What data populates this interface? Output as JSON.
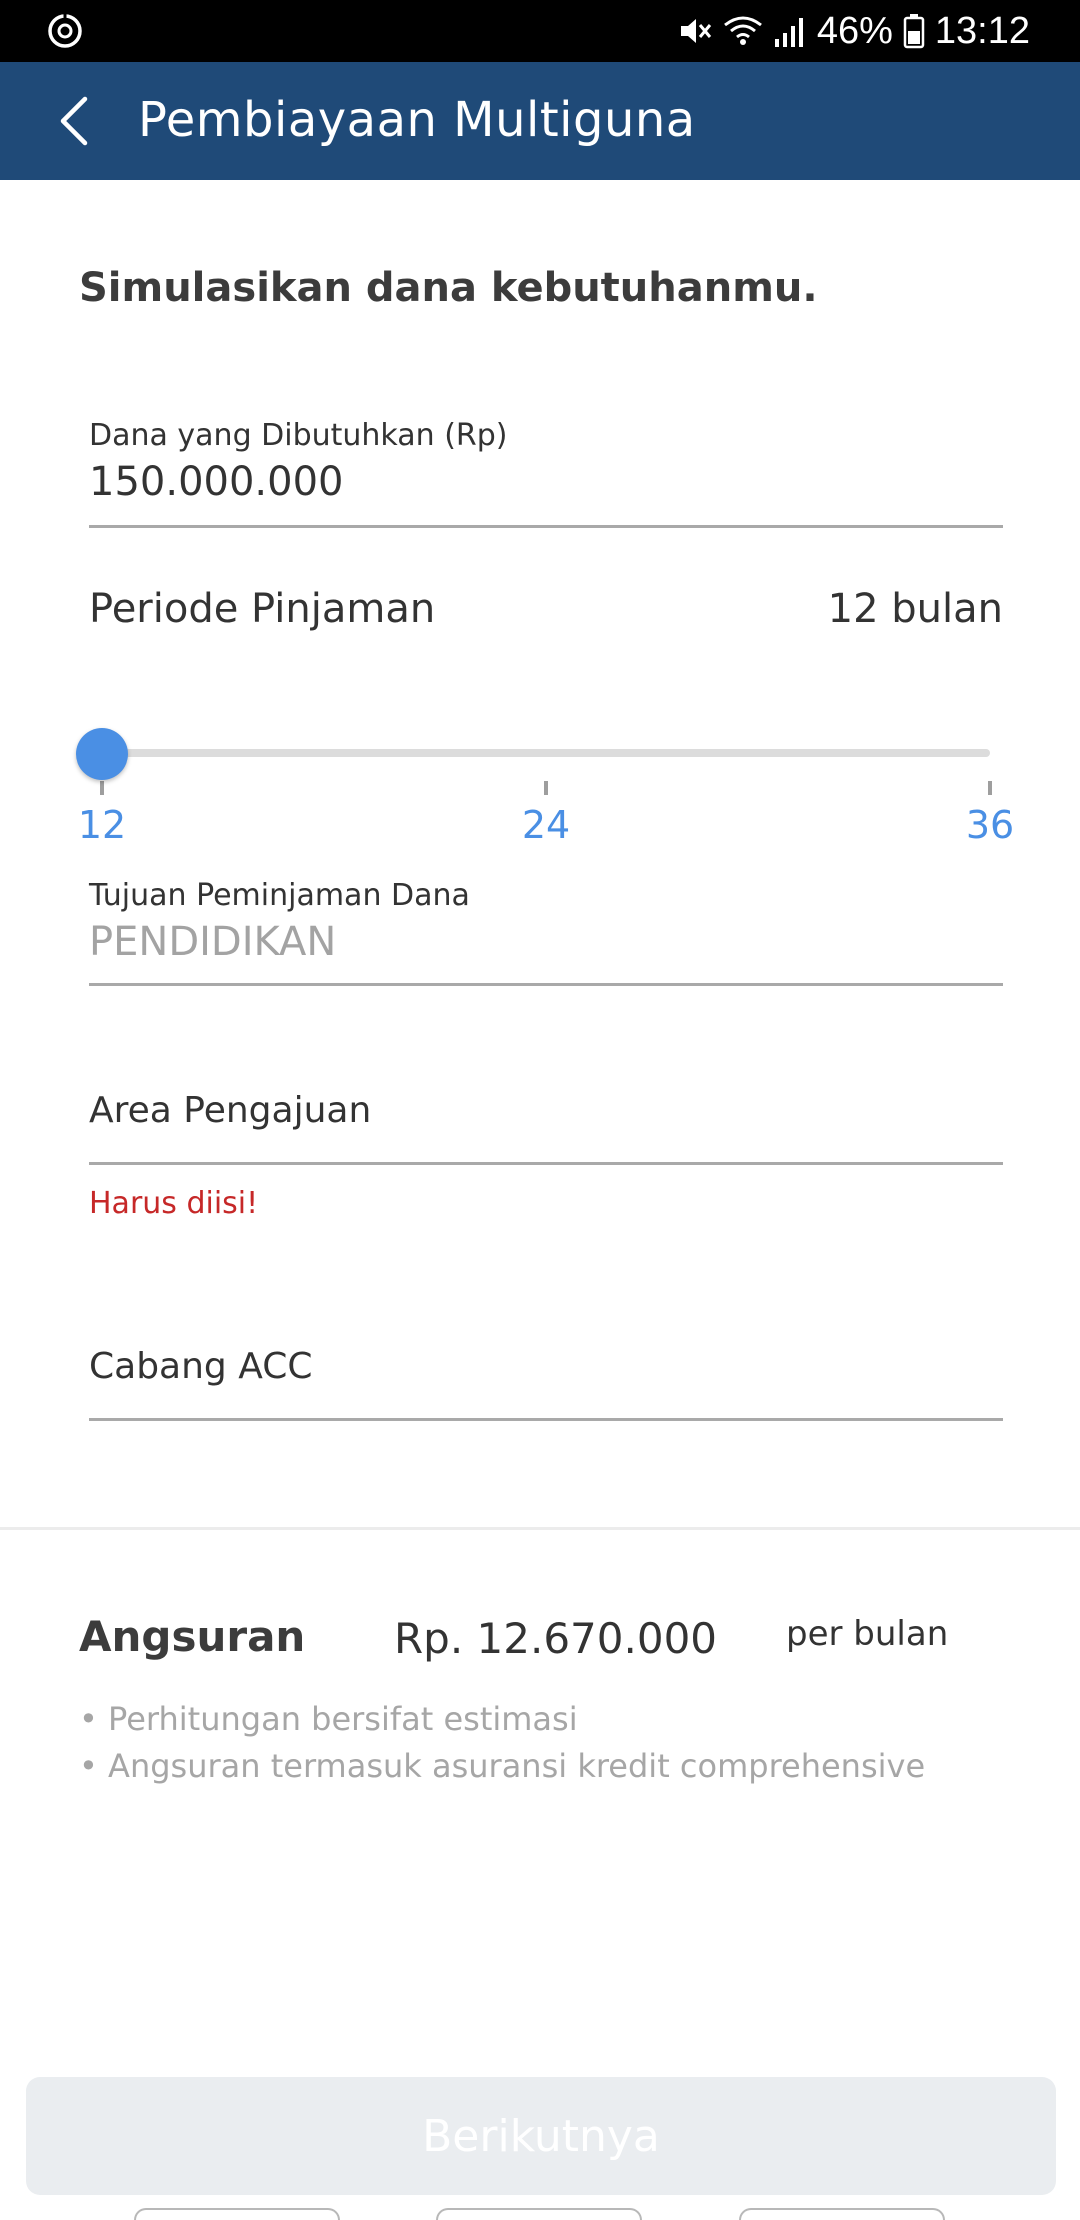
{
  "status_bar": {
    "battery": "46%",
    "time": "13:12",
    "icons": [
      "sync-icon",
      "mute-icon",
      "wifi-icon",
      "signal-icon",
      "battery-icon"
    ]
  },
  "app_bar": {
    "title": "Pembiayaan Multiguna",
    "back_icon": "chevron-left-icon",
    "background_color": "#1f4a78"
  },
  "form": {
    "headline": "Simulasikan dana kebutuhanmu.",
    "dana": {
      "label": "Dana yang Dibutuhkan (Rp)",
      "value": "150.000.000"
    },
    "periode": {
      "label": "Periode Pinjaman",
      "value_text": "12 bulan",
      "slider": {
        "min": 12,
        "max": 36,
        "current": 12,
        "ticks": [
          "12",
          "24",
          "36"
        ],
        "accent_color": "#4a8fe4"
      }
    },
    "tujuan": {
      "label": "Tujuan Peminjaman Dana",
      "value": "PENDIDIKAN"
    },
    "area": {
      "label": "Area Pengajuan",
      "error": "Harus diisi!"
    },
    "cabang": {
      "label": "Cabang ACC"
    }
  },
  "summary": {
    "label": "Angsuran",
    "amount": "Rp. 12.670.000",
    "unit": "per bulan",
    "notes": [
      "• Perhitungan bersifat estimasi",
      "• Angsuran termasuk asuransi kredit comprehensive"
    ]
  },
  "footer": {
    "next_label": "Berikutnya"
  }
}
